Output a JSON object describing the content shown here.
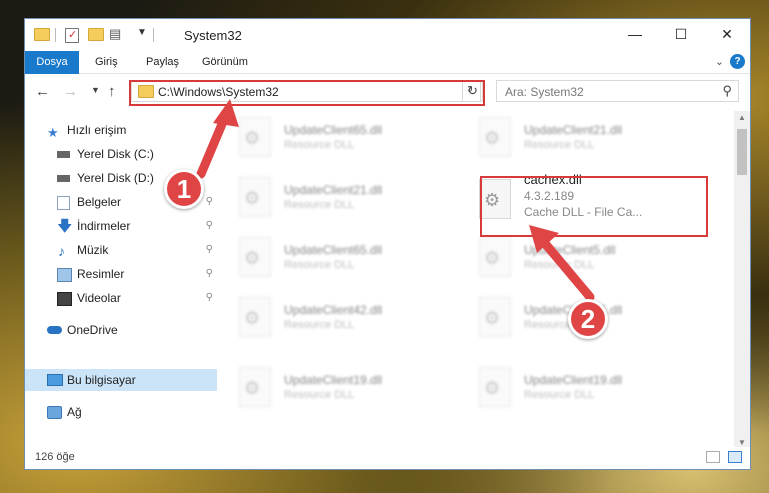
{
  "window": {
    "title": "System32"
  },
  "ribbon": {
    "tabs": [
      "Dosya",
      "Giriş",
      "Paylaş",
      "Görünüm"
    ]
  },
  "window_controls": {
    "minimize": "—",
    "maximize": "☐",
    "close": "✕"
  },
  "nav": {
    "address": "C:\\Windows\\System32",
    "search_placeholder": "Ara: System32"
  },
  "sidebar": {
    "items": [
      {
        "label": "Hızlı erişim",
        "icon": "star-icon"
      },
      {
        "label": "Yerel Disk (C:)",
        "icon": "drive-icon"
      },
      {
        "label": "Yerel Disk (D:)",
        "icon": "drive-icon"
      },
      {
        "label": "Belgeler",
        "icon": "documents-icon"
      },
      {
        "label": "İndirmeler",
        "icon": "download-icon"
      },
      {
        "label": "Müzik",
        "icon": "music-icon"
      },
      {
        "label": "Resimler",
        "icon": "pictures-icon"
      },
      {
        "label": "Videolar",
        "icon": "videos-icon"
      },
      {
        "label": "OneDrive",
        "icon": "cloud-icon"
      },
      {
        "label": "Bu bilgisayar",
        "icon": "computer-icon"
      },
      {
        "label": "Ağ",
        "icon": "network-icon"
      }
    ]
  },
  "files": [
    {
      "name": "UpdateClient65.dll",
      "desc": "Resource DLL"
    },
    {
      "name": "UpdateClient21.dll",
      "desc": "Resource DLL"
    },
    {
      "name": "UpdateClient21.dll",
      "desc": "Resource DLL"
    },
    {
      "name": "cachex.dll",
      "version": "4.3.2.189",
      "desc": "Cache DLL - File Ca..."
    },
    {
      "name": "UpdateClient65.dll",
      "desc": "Resource DLL"
    },
    {
      "name": "UpdateClient5.dll",
      "desc": "Resource DLL"
    },
    {
      "name": "UpdateClient42.dll",
      "desc": "Resource DLL"
    },
    {
      "name": "UpdateClient65.dll",
      "desc": "Resource DLL"
    },
    {
      "name": "UpdateClient19.dll",
      "desc": "Resource DLL"
    },
    {
      "name": "UpdateClient19.dll",
      "desc": "Resource DLL"
    }
  ],
  "status": {
    "count": "126 öğe"
  },
  "annotations": {
    "step1": "1",
    "step2": "2"
  },
  "colors": {
    "accent": "#1979ca",
    "highlight": "#d73a3a",
    "selected": "#cce4f7"
  }
}
